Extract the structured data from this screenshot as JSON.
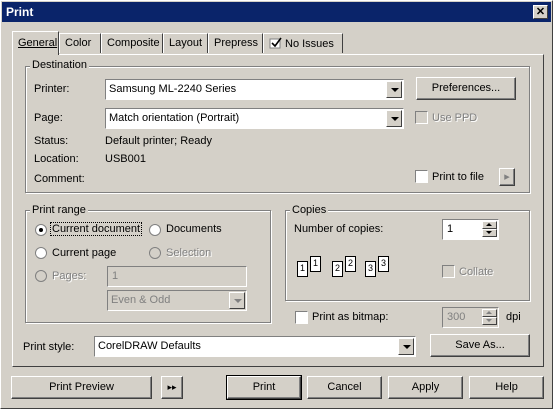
{
  "window": {
    "title": "Print",
    "close": "✕"
  },
  "tabs": [
    {
      "label": "General"
    },
    {
      "label": "Color"
    },
    {
      "label": "Composite"
    },
    {
      "label": "Layout"
    },
    {
      "label": "Prepress"
    },
    {
      "label": "No Issues"
    }
  ],
  "destination": {
    "legend": "Destination",
    "printer_label": "Printer:",
    "printer_value": "Samsung ML-2240 Series",
    "preferences_button": "Preferences...",
    "page_label": "Page:",
    "page_value": "Match orientation (Portrait)",
    "use_ppd": "Use PPD",
    "status_label": "Status:",
    "status_value": "Default printer; Ready",
    "location_label": "Location:",
    "location_value": "USB001",
    "comment_label": "Comment:",
    "comment_value": "",
    "print_to_file": "Print to file",
    "file_menu_arrow": "▸"
  },
  "print_range": {
    "legend": "Print range",
    "current_document": "Current document",
    "documents": "Documents",
    "current_page": "Current page",
    "selection": "Selection",
    "pages_label": "Pages:",
    "pages_value": "1",
    "even_odd": "Even & Odd"
  },
  "copies": {
    "legend": "Copies",
    "number_label": "Number of copies:",
    "number_value": "1",
    "collate": "Collate",
    "icon_pages": [
      "1",
      "1",
      "2",
      "2",
      "3",
      "3"
    ]
  },
  "bitmap": {
    "label": "Print as bitmap:",
    "dpi_value": "300",
    "dpi_unit": "dpi"
  },
  "print_style": {
    "label": "Print style:",
    "value": "CorelDRAW Defaults",
    "save_as": "Save As..."
  },
  "footer": {
    "print_preview": "Print Preview",
    "expand": "▸▸",
    "print": "Print",
    "cancel": "Cancel",
    "apply": "Apply",
    "help": "Help"
  }
}
